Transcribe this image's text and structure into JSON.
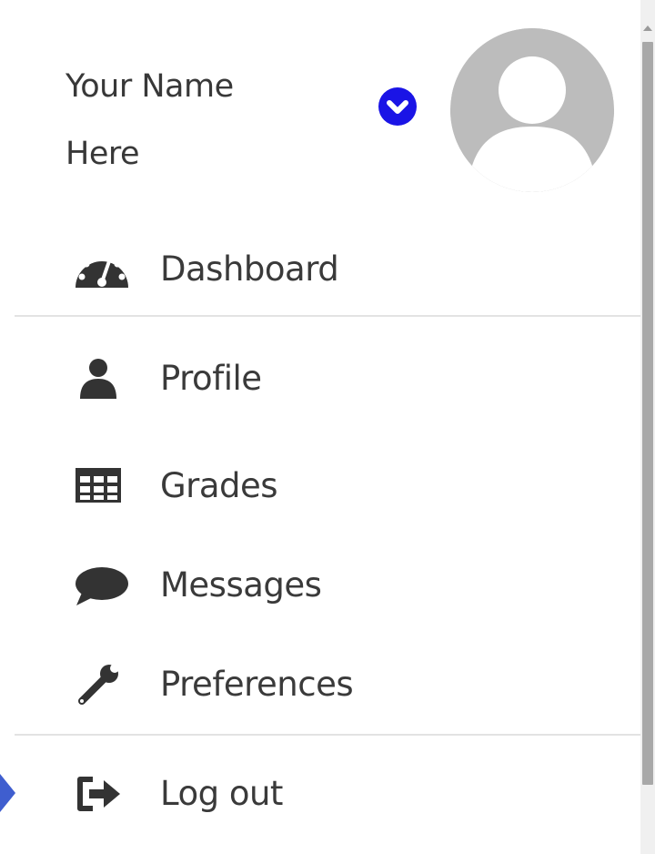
{
  "user": {
    "name": "Your Name Here",
    "toggle_color": "#1a14e6"
  },
  "menu": {
    "items": [
      {
        "label": "Dashboard",
        "icon": "dashboard-icon"
      },
      {
        "label": "Profile",
        "icon": "user-icon"
      },
      {
        "label": "Grades",
        "icon": "table-icon"
      },
      {
        "label": "Messages",
        "icon": "speech-bubble-icon"
      },
      {
        "label": "Preferences",
        "icon": "wrench-icon"
      },
      {
        "label": "Log out",
        "icon": "sign-out-icon"
      }
    ]
  },
  "colors": {
    "icon": "#333333",
    "divider": "#e3e3e3",
    "avatar_bg": "#bcbcbc",
    "pointer": "#3f5ecf"
  }
}
